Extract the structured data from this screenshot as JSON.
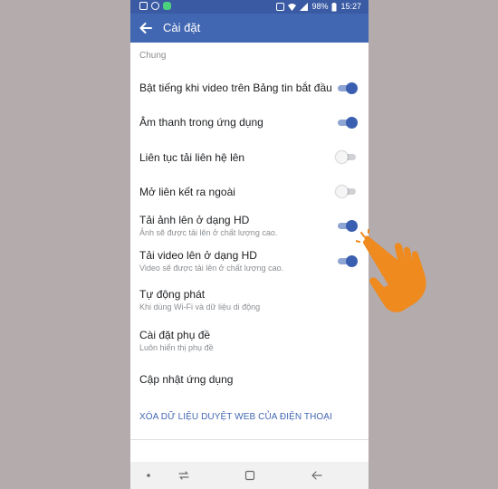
{
  "statusbar": {
    "battery_percent": "98%",
    "time": "15:27"
  },
  "appbar": {
    "title": "Cài đặt",
    "back_icon": "arrow-left-icon"
  },
  "section": {
    "label": "Chung"
  },
  "settings": [
    {
      "title": "Bật tiếng khi video trên Bảng tin bắt đầu",
      "subtitle": "",
      "toggle": true
    },
    {
      "title": "Âm thanh trong ứng dụng",
      "subtitle": "",
      "toggle": true
    },
    {
      "title": "Liên tục tải liên hệ lên",
      "subtitle": "",
      "toggle": false
    },
    {
      "title": "Mở liên kết ra ngoài",
      "subtitle": "",
      "toggle": false
    },
    {
      "title": "Tải ảnh lên ở dạng HD",
      "subtitle": "Ảnh sẽ được tải lên ở chất lượng cao.",
      "toggle": true
    },
    {
      "title": "Tải video lên ở dạng HD",
      "subtitle": "Video sẽ được tải lên ở chất lượng cao.",
      "toggle": true
    },
    {
      "title": "Tự động phát",
      "subtitle": "Khi dùng Wi-Fi và dữ liệu di động"
    },
    {
      "title": "Cài đặt phụ đề",
      "subtitle": "Luôn hiển thị phụ đề"
    },
    {
      "title": "Cập nhật ứng dụng",
      "subtitle": ""
    }
  ],
  "clear_data_link": "XÓA DỮ LIỆU DUYỆT WEB CỦA ĐIỆN THOẠI",
  "colors": {
    "header": "#4267b2",
    "statusbar": "#3a5ba4",
    "toggle_on": "#3b5fb0",
    "hand": "#ef8a1f",
    "background": "#b3abac"
  },
  "navigation": [
    "dot-icon",
    "recent-apps-icon",
    "home-icon",
    "back-icon"
  ]
}
